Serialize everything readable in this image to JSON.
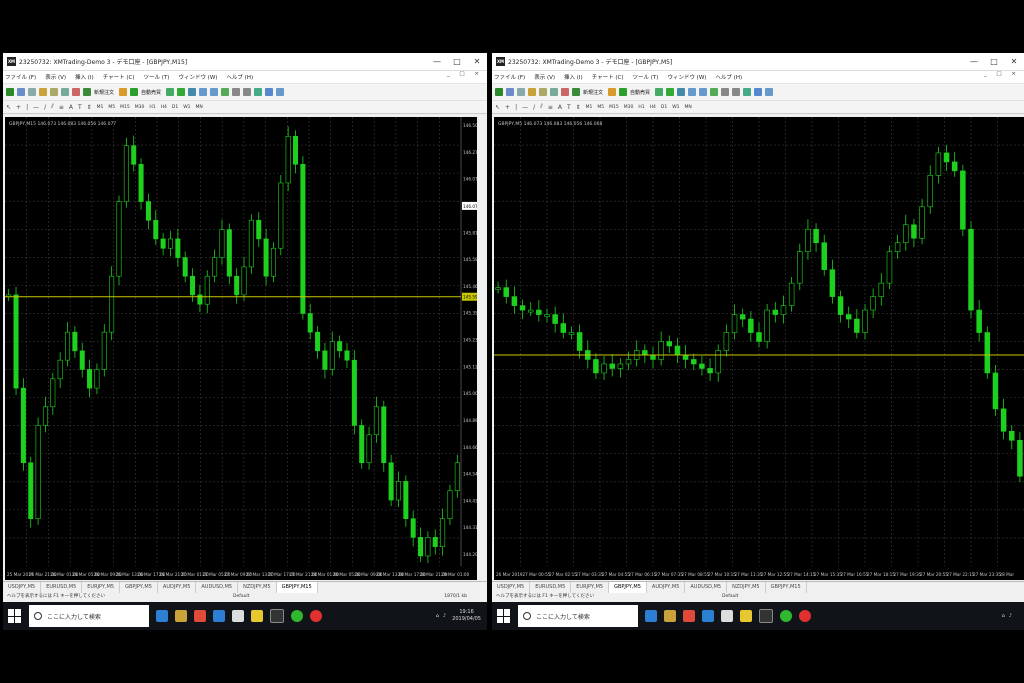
{
  "windows": [
    {
      "id": "left",
      "title": "23250732: XMTrading-Demo 3 - デモ口座 - [GBPJPY,M15]",
      "app_icon": "XM",
      "window_controls": [
        "—",
        "□",
        "✕"
      ],
      "menu": [
        "ファイル (F)",
        "表示 (V)",
        "挿入 (I)",
        "チャート (C)",
        "ツール (T)",
        "ウィンドウ (W)",
        "ヘルプ (H)"
      ],
      "mdi_controls": "_ □ ×",
      "toolbar": {
        "new_order": "新規注文",
        "auto_trading": "自動売買"
      },
      "timeframes": [
        "M1",
        "M5",
        "M15",
        "M30",
        "H1",
        "H4",
        "D1",
        "W1",
        "MN"
      ],
      "chart_label": "GBPJPY,M15  146.073 146.083 146.056 146.077",
      "price_axis": [
        "146.500",
        "146.270",
        "146.077",
        "145.925",
        "145.810",
        "145.590",
        "145.465",
        "145.350",
        "145.235",
        "145.120",
        "145.005",
        "144.890",
        "144.660",
        "144.545",
        "144.430",
        "144.315",
        "144.200"
      ],
      "current_price_label": "146.077",
      "hline_label": "145.590",
      "time_axis": [
        "25 Mar 2019",
        "25 Mar 21:00",
        "26 Mar 01:00",
        "26 Mar 05:00",
        "26 Mar 09:00",
        "26 Mar 13:00",
        "26 Mar 17:00",
        "26 Mar 21:00",
        "27 Mar 01:00",
        "27 Mar 05:00",
        "27 Mar 09:00",
        "27 Mar 13:00",
        "27 Mar 17:00",
        "27 Mar 21:00",
        "28 Mar 01:00",
        "28 Mar 05:00",
        "28 Mar 09:00",
        "28 Mar 13:00",
        "28 Mar 17:00",
        "28 Mar 21:00",
        "29 Mar 01:00"
      ],
      "tabs": [
        "USDJPY,M5",
        "EURUSD,M5",
        "EURJPY,M5",
        "GBPJPY,M5",
        "AUDJPY,M5",
        "AUDUSD,M5",
        "NZDJPY,M5",
        "GBPJPY,M15"
      ],
      "active_tab": 7,
      "status": {
        "help": "ヘルプを表示するには F1 キーを押してください",
        "profile": "Default",
        "conn": "1870/1 kb"
      },
      "taskbar": {
        "search_placeholder": "ここに入力して検索",
        "time": "19:16",
        "date": "2019/04/05"
      }
    },
    {
      "id": "right",
      "title": "23250732: XMTrading-Demo 3 - デモ口座 - [GBPJPY,M5]",
      "app_icon": "XM",
      "window_controls": [
        "—",
        "□",
        "✕"
      ],
      "menu": [
        "ファイル (F)",
        "表示 (V)",
        "挿入 (I)",
        "チャート (C)",
        "ツール (T)",
        "ウィンドウ (W)",
        "ヘルプ (H)"
      ],
      "mdi_controls": "_ □ ×",
      "toolbar": {
        "new_order": "新規注文",
        "auto_trading": "自動売買"
      },
      "timeframes": [
        "M1",
        "M5",
        "M15",
        "M30",
        "H1",
        "H4",
        "D1",
        "W1",
        "MN"
      ],
      "chart_label": "GBPJPY,M5  146.073 146.083 146.056 146.068",
      "time_axis": [
        "26 Mar 2019",
        "27 Mar 00:55",
        "27 Mar 02:15",
        "27 Mar 03:35",
        "27 Mar 04:55",
        "27 Mar 06:15",
        "27 Mar 07:35",
        "27 Mar 08:55",
        "27 Mar 10:15",
        "27 Mar 11:35",
        "27 Mar 12:55",
        "27 Mar 14:15",
        "27 Mar 15:35",
        "27 Mar 16:55",
        "27 Mar 18:15",
        "27 Mar 19:35",
        "27 Mar 20:55",
        "27 Mar 22:15",
        "27 Mar 23:35",
        "28 Mar"
      ],
      "tabs": [
        "USDJPY,M5",
        "EURUSD,M5",
        "EURJPY,M5",
        "GBPJPY,M5",
        "AUDJPY,M5",
        "AUDUSD,M5",
        "NZDJPY,M5",
        "GBPJPY,M15"
      ],
      "active_tab": 3,
      "status": {
        "help": "ヘルプを表示するには F1 キーを押してください",
        "profile": "Default",
        "conn": ""
      },
      "taskbar": {
        "search_placeholder": "ここに入力して検索",
        "time": "",
        "date": ""
      }
    }
  ],
  "colors": {
    "candle_up": "#1fd11f",
    "candle_down": "#1fd11f",
    "grid": "#3a3a3a",
    "hline": "#c8c800",
    "axis_text": "#c8c8c8"
  },
  "chart_data": [
    {
      "type": "candlestick",
      "symbol": "GBPJPY",
      "timeframe": "M15",
      "ylim": [
        144.2,
        146.5
      ],
      "hline": 145.59,
      "series": [
        {
          "name": "",
          "close": [
            145.6,
            145.1,
            144.7,
            144.4,
            144.9,
            145.0,
            145.15,
            145.25,
            145.4,
            145.3,
            145.2,
            145.1,
            145.2,
            145.4,
            145.7,
            146.1,
            146.4,
            146.3,
            146.1,
            146.0,
            145.9,
            145.85,
            145.9,
            145.8,
            145.7,
            145.6,
            145.55,
            145.7,
            145.8,
            145.95,
            145.7,
            145.6,
            145.75,
            146.0,
            145.9,
            145.7,
            145.85,
            146.2,
            146.45,
            146.3,
            145.5,
            145.4,
            145.3,
            145.2,
            145.35,
            145.3,
            145.25,
            144.9,
            144.7,
            144.85,
            145.0,
            144.7,
            144.5,
            144.6,
            144.4,
            144.3,
            144.2,
            144.3,
            144.25,
            144.4,
            144.55,
            144.7
          ]
        }
      ]
    },
    {
      "type": "candlestick",
      "symbol": "GBPJPY",
      "timeframe": "M5",
      "hline_share_of_height": 0.53,
      "series": [
        {
          "name": "",
          "close": [
            0.62,
            0.6,
            0.58,
            0.57,
            0.57,
            0.56,
            0.56,
            0.54,
            0.52,
            0.52,
            0.48,
            0.46,
            0.43,
            0.45,
            0.44,
            0.45,
            0.46,
            0.48,
            0.47,
            0.46,
            0.5,
            0.49,
            0.47,
            0.46,
            0.45,
            0.44,
            0.43,
            0.48,
            0.52,
            0.56,
            0.55,
            0.52,
            0.5,
            0.57,
            0.56,
            0.58,
            0.63,
            0.7,
            0.75,
            0.72,
            0.66,
            0.6,
            0.56,
            0.55,
            0.52,
            0.57,
            0.6,
            0.63,
            0.7,
            0.72,
            0.76,
            0.73,
            0.8,
            0.87,
            0.92,
            0.9,
            0.88,
            0.75,
            0.57,
            0.52,
            0.43,
            0.35,
            0.3,
            0.28,
            0.2
          ]
        }
      ]
    }
  ]
}
